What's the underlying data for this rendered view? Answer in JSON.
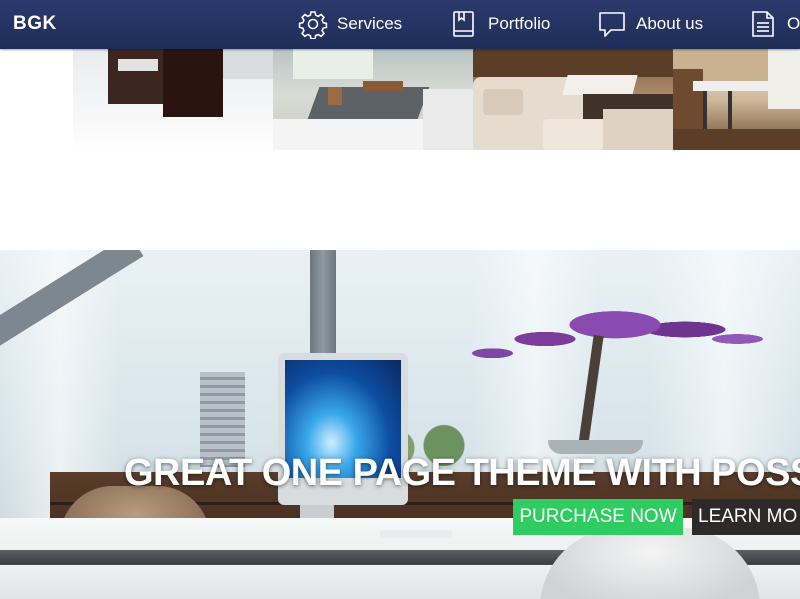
{
  "brand": {
    "name": "BGK"
  },
  "nav": {
    "items": [
      {
        "label": "Services",
        "icon": "gear-icon"
      },
      {
        "label": "Portfolio",
        "icon": "book-icon"
      },
      {
        "label": "About us",
        "icon": "speech-bubble-icon"
      },
      {
        "label": "O",
        "icon": "document-icon"
      }
    ]
  },
  "portfolio": {
    "thumbnails": [
      "kitchen-interior",
      "living-room-interior",
      "beige-sofa-interior",
      "dining-room-interior"
    ]
  },
  "hero": {
    "title": "GREAT ONE PAGE THEME WITH POSS",
    "purchase_label": "PURCHASE NOW",
    "learn_label": "LEARN MO"
  },
  "colors": {
    "navbar": "#253466",
    "purchase_button": "#2ecc61",
    "learn_button": "#2d2a2a",
    "text_light": "#ffffff"
  }
}
